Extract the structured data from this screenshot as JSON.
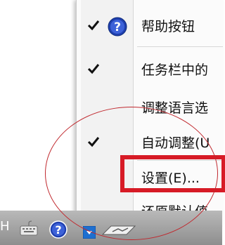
{
  "context_menu": {
    "items": [
      {
        "label": "帮助按钮",
        "checked": true,
        "icon": "help-circle-icon"
      },
      {
        "label": "任务栏中的",
        "checked": true
      },
      {
        "label": "调整语言选",
        "checked": false
      },
      {
        "label": "自动调整(U",
        "checked": true
      },
      {
        "label": "设置(E)...",
        "checked": false,
        "highlighted": true
      },
      {
        "label": "还原默认值",
        "checked": false
      }
    ]
  },
  "taskbar": {
    "language_letter": "H",
    "icons": [
      "keyboard-icon",
      "help-icon",
      "expand-arrow-icon",
      "language-bar-icon"
    ]
  },
  "colors": {
    "highlight": "#d71b26",
    "taskbar": "#a6a6a6",
    "help_blue": "#1f3fae"
  }
}
